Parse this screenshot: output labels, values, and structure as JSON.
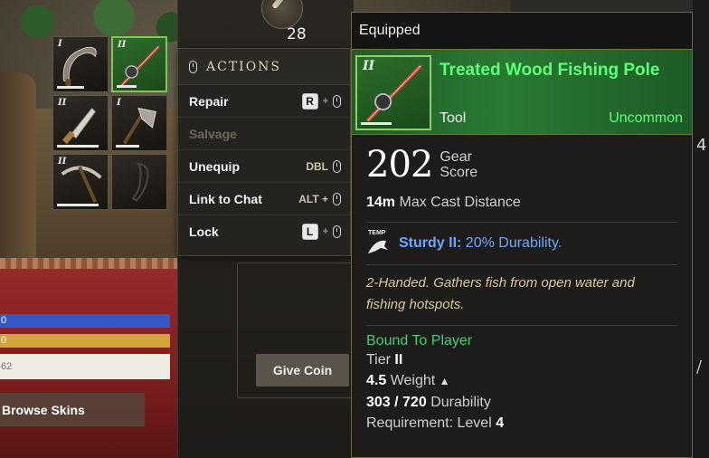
{
  "quiver": {
    "count": "28"
  },
  "inventory": {
    "slots": [
      {
        "tier": "I",
        "item": "sickle",
        "durability": 0.55,
        "selected": false
      },
      {
        "tier": "II",
        "item": "fishing-pole",
        "durability": 0.45,
        "selected": true
      },
      {
        "tier": "II",
        "item": "skinning-knife",
        "durability": 0.85,
        "selected": false
      },
      {
        "tier": "I",
        "item": "hatchet",
        "durability": 0.5,
        "selected": false
      },
      {
        "tier": "II",
        "item": "pickaxe",
        "durability": 0.85,
        "selected": false
      },
      {
        "tier": "",
        "item": "empty-slot",
        "durability": 0,
        "selected": false
      }
    ]
  },
  "actions": {
    "title": "ACTIONS",
    "items": [
      {
        "label": "Repair",
        "key": "R",
        "modifier": "",
        "mouse": true,
        "disabled": false
      },
      {
        "label": "Salvage",
        "key": "",
        "modifier": "",
        "mouse": false,
        "disabled": true
      },
      {
        "label": "Unequip",
        "key": "",
        "modifier": "DBL",
        "mouse": true,
        "disabled": false
      },
      {
        "label": "Link to Chat",
        "key": "",
        "modifier": "ALT +",
        "mouse": true,
        "disabled": false
      },
      {
        "label": "Lock",
        "key": "L",
        "modifier": "",
        "mouse": true,
        "disabled": false
      }
    ]
  },
  "bars": {
    "blue": "0",
    "yellow": "0",
    "white": "62"
  },
  "buttons": {
    "browse_skins": "Browse Skins",
    "give_coin": "Give Coin"
  },
  "tooltip": {
    "header": "Equipped",
    "item_tier": "II",
    "item_name": "Treated Wood Fishing Pole",
    "item_type": "Tool",
    "rarity": "Uncommon",
    "gear_score": "202",
    "gear_score_label": "Gear Score",
    "max_cast_value": "14m",
    "max_cast_label": "Max Cast Distance",
    "perk_badge": "TEMP",
    "perk_name": "Sturdy II:",
    "perk_desc": "20% Durability.",
    "description": "2-Handed. Gathers fish from open water and fishing hotspots.",
    "bound": "Bound To Player",
    "tier_label": "Tier",
    "tier_value": "II",
    "weight_value": "4.5",
    "weight_label": "Weight",
    "durability_value": "303 / 720",
    "durability_label": "Durability",
    "requirement_label": "Requirement: Level",
    "requirement_value": "4"
  },
  "colors": {
    "rarity_green": "#5dff7a",
    "perk_blue": "#6aa8ff",
    "bound_green": "#3fd078",
    "description_tan": "#d6c9a3"
  }
}
